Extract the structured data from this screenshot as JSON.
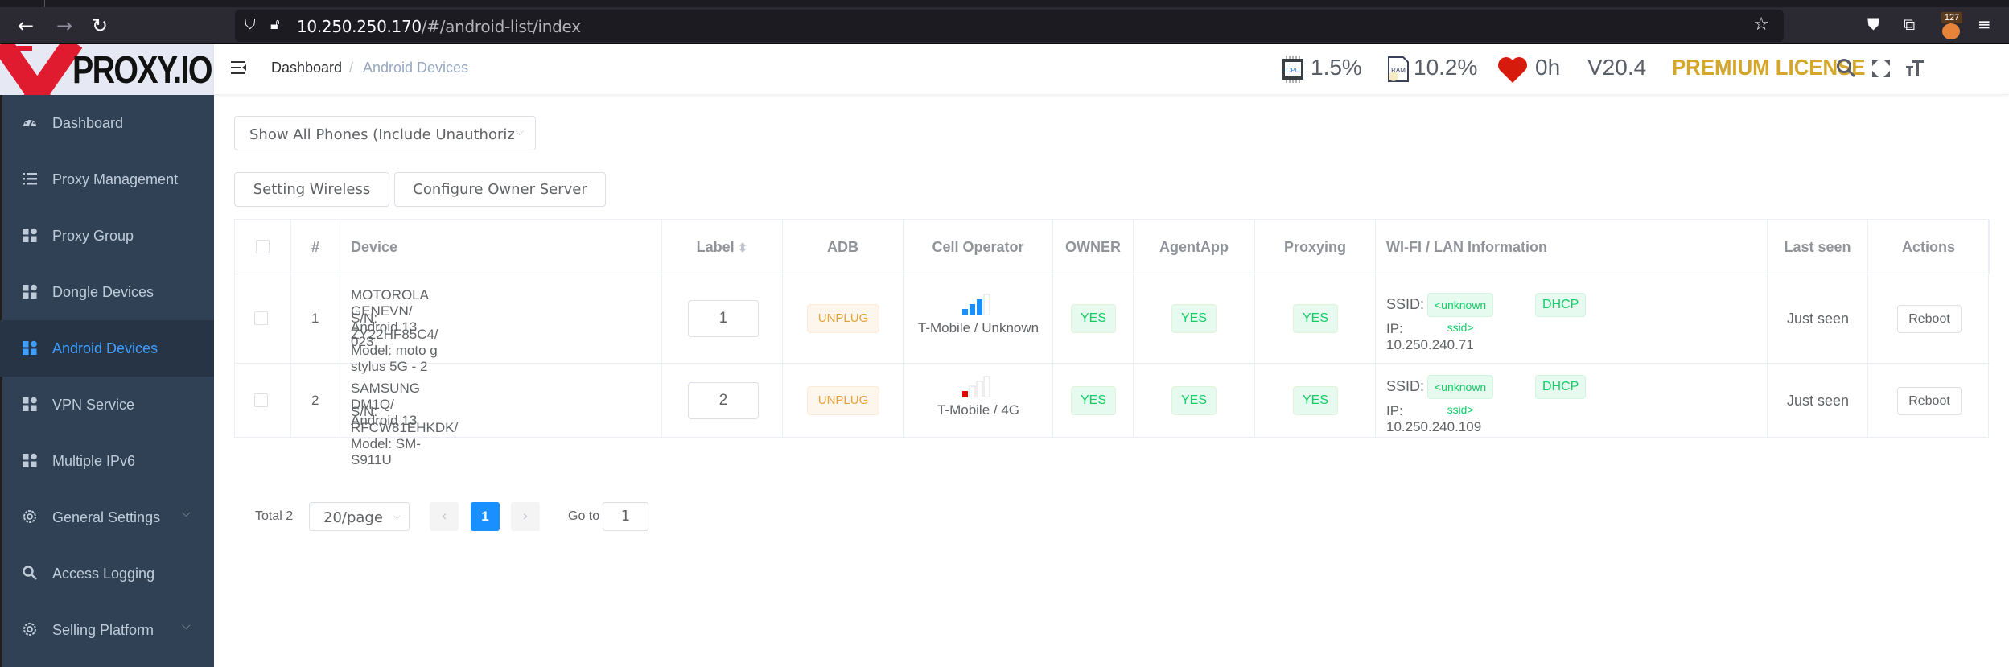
{
  "browser": {
    "url_host": "10.250.250.170",
    "url_path": "/#/android-list/index",
    "extension_badge": "127",
    "icons": [
      "back-icon",
      "forward-icon",
      "reload-icon",
      "shield-icon",
      "insecure-lock-icon",
      "bookmark-star-icon",
      "pocket-icon",
      "extensions-icon",
      "menu-icon"
    ]
  },
  "logo": {
    "text": "PROXY.IO",
    "accent": "#e01b2f"
  },
  "sidebar": {
    "bg": "#304156",
    "active_color": "#409eff",
    "items": [
      {
        "label": "Dashboard",
        "icon": "dashboard-gauge-icon",
        "active": false,
        "has_submenu": false
      },
      {
        "label": "Proxy Management",
        "icon": "list-icon",
        "active": false,
        "has_submenu": false
      },
      {
        "label": "Proxy Group",
        "icon": "grid-icon",
        "active": false,
        "has_submenu": false
      },
      {
        "label": "Dongle Devices",
        "icon": "grid-icon",
        "active": false,
        "has_submenu": false
      },
      {
        "label": "Android Devices",
        "icon": "grid-icon",
        "active": true,
        "has_submenu": false
      },
      {
        "label": "VPN Service",
        "icon": "grid-icon",
        "active": false,
        "has_submenu": false
      },
      {
        "label": "Multiple IPv6",
        "icon": "grid-icon",
        "active": false,
        "has_submenu": false
      },
      {
        "label": "General Settings",
        "icon": "gear-icon",
        "active": false,
        "has_submenu": true
      },
      {
        "label": "Access Logging",
        "icon": "search-icon",
        "active": false,
        "has_submenu": false
      },
      {
        "label": "Selling Platform",
        "icon": "gear-icon",
        "active": false,
        "has_submenu": true
      }
    ]
  },
  "header": {
    "breadcrumb": [
      "Dashboard",
      "Android Devices"
    ],
    "breadcrumb_sep": "/",
    "cpu": "1.5%",
    "ram": "10.2%",
    "uptime": "0h",
    "version": "V20.4",
    "license": "PREMIUM LICENSE",
    "license_color": "#d4a62a"
  },
  "toolbar": {
    "filter_value": "Show All Phones (Include Unauthoriz",
    "setting_wireless": "Setting Wireless",
    "configure_owner_server": "Configure Owner Server"
  },
  "table": {
    "columns": [
      "",
      "#",
      "Device",
      "Label",
      "ADB",
      "Cell Operator",
      "OWNER",
      "AgentApp",
      "Proxying",
      "WI-FI / LAN Information",
      "Last seen",
      "Actions"
    ],
    "rows": [
      {
        "index": "1",
        "device_line1": "MOTOROLA GENEVN/ Android 13",
        "device_line2": "S/N: ZY22HF85C4/ Model: moto g stylus 5G - 2",
        "device_line3": "023",
        "label": "1",
        "adb": "UNPLUG",
        "signal_bars": 3,
        "signal_max": 4,
        "signal_color": "#1890ff",
        "operator": "T-Mobile / Unknown",
        "owner": "YES",
        "agentapp": "YES",
        "proxying": "YES",
        "ssid_label": "SSID:",
        "ssid": "<unknown ssid>",
        "ip_mode": "DHCP",
        "ip": "IP: 10.250.240.71",
        "last_seen": "Just seen",
        "action": "Reboot"
      },
      {
        "index": "2",
        "device_line1": "SAMSUNG DM1Q/ Android 13",
        "device_line2": "S/N: RFCW81EHKDK/ Model: SM-S911U",
        "device_line3": "",
        "label": "2",
        "adb": "UNPLUG",
        "signal_bars": 1,
        "signal_max": 4,
        "signal_color": "#e00000",
        "operator": "T-Mobile / 4G",
        "owner": "YES",
        "agentapp": "YES",
        "proxying": "YES",
        "ssid_label": "SSID:",
        "ssid": "<unknown ssid>",
        "ip_mode": "DHCP",
        "ip": "IP: 10.250.240.109",
        "last_seen": "Just seen",
        "action": "Reboot"
      }
    ]
  },
  "pagination": {
    "total": "Total 2",
    "page_size": "20/page",
    "prev": "‹",
    "current": "1",
    "next": "›",
    "goto_label": "Go to",
    "goto_value": "1"
  }
}
